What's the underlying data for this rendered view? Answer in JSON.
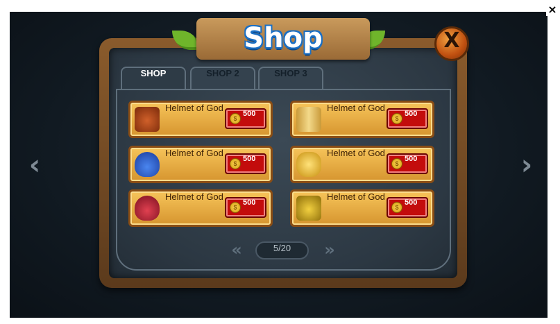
{
  "window": {
    "close_glyph": "×"
  },
  "nav": {
    "prev_glyph": "‹",
    "next_glyph": "›"
  },
  "title": "Shop",
  "close_button": {
    "glyph": "X"
  },
  "tabs": [
    {
      "label": "SHOP",
      "active": true
    },
    {
      "label": "SHOP 2",
      "active": false
    },
    {
      "label": "SHOP 3",
      "active": false
    }
  ],
  "items": [
    {
      "name": "Helmet of God",
      "price": "500",
      "icon": "helmet-red-icon",
      "color": "#b8451a"
    },
    {
      "name": "Helmet of God",
      "price": "500",
      "icon": "scroll-icon",
      "color": "#e6c15a"
    },
    {
      "name": "Helmet of God",
      "price": "500",
      "icon": "blue-potion-icon",
      "color": "#2c5fc7"
    },
    {
      "name": "Helmet of God",
      "price": "500",
      "icon": "gold-ingots-icon",
      "color": "#e8b830"
    },
    {
      "name": "Helmet of God",
      "price": "500",
      "icon": "red-potion-icon",
      "color": "#c4283a"
    },
    {
      "name": "Helmet of God",
      "price": "500",
      "icon": "helmet-gold-icon",
      "color": "#d8b020"
    }
  ],
  "coin_glyph": "$",
  "pagination": {
    "text": "5/20",
    "prev_glyph": "«",
    "next_glyph": "»"
  }
}
